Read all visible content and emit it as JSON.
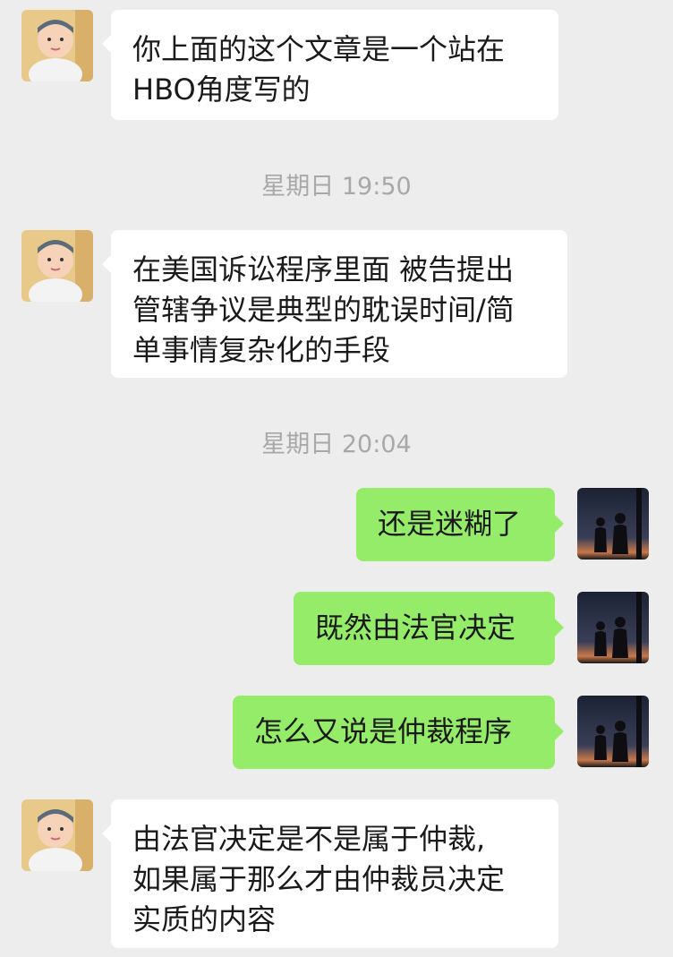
{
  "messages": [
    {
      "side": "in",
      "lines": [
        "你上面的这个文章是一个站在",
        "HBO角度写的"
      ]
    },
    {
      "side": "in",
      "lines": [
        "在美国诉讼程序里面 被告提出",
        "管辖争议是典型的耽误时间/简",
        "单事情复杂化的手段"
      ]
    },
    {
      "side": "out",
      "lines": [
        "还是迷糊了"
      ]
    },
    {
      "side": "out",
      "lines": [
        "既然由法官决定"
      ]
    },
    {
      "side": "out",
      "lines": [
        "怎么又说是仲裁程序"
      ]
    },
    {
      "side": "in",
      "lines": [
        "由法官决定是不是属于仲裁,",
        "如果属于那么才由仲裁员决定",
        "实质的内容"
      ]
    }
  ],
  "timestamps": [
    "星期日 19:50",
    "星期日 20:04"
  ],
  "icons": {
    "incoming_avatar": "baby-avatar-icon",
    "outgoing_avatar": "sunset-couple-avatar-icon"
  },
  "colors": {
    "background": "#ededed",
    "incoming_bubble": "#ffffff",
    "outgoing_bubble": "#95ec69",
    "timestamp": "#a8a8a8"
  }
}
